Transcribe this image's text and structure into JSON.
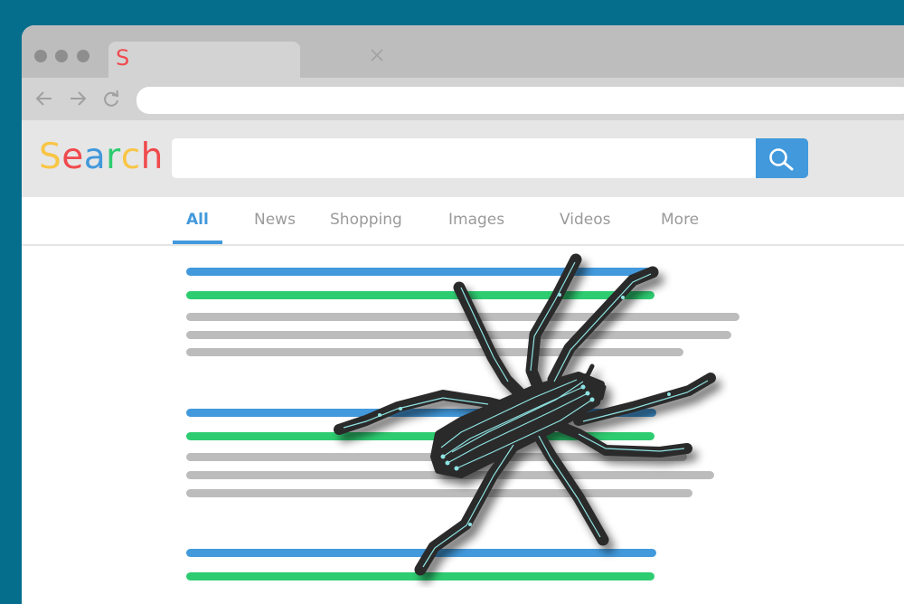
{
  "browser": {
    "tab": {
      "favicon_letter": "S",
      "favicon_color": "#F04A4D"
    },
    "icons": {
      "window_controls": [
        "dot",
        "dot",
        "dot"
      ],
      "close": "close-icon",
      "back": "back-arrow-icon",
      "forward": "forward-arrow-icon",
      "reload": "reload-icon"
    },
    "address_bar": {
      "value": "",
      "placeholder": ""
    }
  },
  "search": {
    "logo": [
      {
        "char": "S",
        "color": "#F9C545"
      },
      {
        "char": "e",
        "color": "#F04A4D"
      },
      {
        "char": "a",
        "color": "#4299DB"
      },
      {
        "char": "r",
        "color": "#2ECC71"
      },
      {
        "char": "c",
        "color": "#F9C545"
      },
      {
        "char": "h",
        "color": "#F04A4D"
      }
    ],
    "input": {
      "value": "",
      "placeholder": ""
    },
    "button_icon": "search-icon"
  },
  "tabs": [
    {
      "label": "All",
      "active": true
    },
    {
      "label": "News",
      "active": false
    },
    {
      "label": "Shopping",
      "active": false
    },
    {
      "label": "Images",
      "active": false
    },
    {
      "label": "Videos",
      "active": false
    },
    {
      "label": "More",
      "active": false
    }
  ],
  "results": [
    {
      "title_bar": "blue",
      "url_bar": "green",
      "snippet_lines": 3
    },
    {
      "title_bar": "blue",
      "url_bar": "green",
      "snippet_lines": 3
    },
    {
      "title_bar": "blue",
      "url_bar": "green",
      "snippet_lines": 0
    }
  ],
  "colors": {
    "background": "#066E8D",
    "accent_blue": "#4299DB",
    "accent_green": "#2ECC71",
    "placeholder_gray": "#BCBCBC",
    "spider_body": "#2A2A2A",
    "spider_circuit": "#8FE3E3"
  },
  "overlay": {
    "subject": "circuit-board spider (web crawler)"
  }
}
